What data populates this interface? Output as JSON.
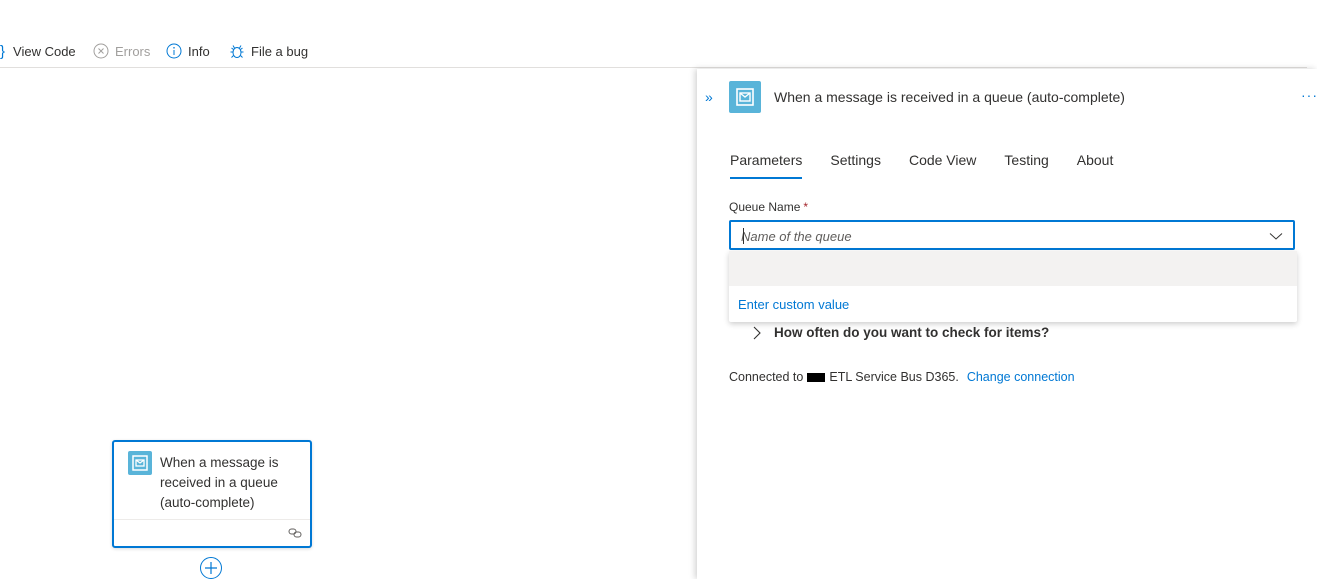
{
  "toolbar": {
    "view_code": "View Code",
    "errors": "Errors",
    "info": "Info",
    "file_bug": "File a bug"
  },
  "canvas": {
    "card_title": "When a message is received in a queue (auto-complete)"
  },
  "panel": {
    "collapse": "»",
    "title": "When a message is received in a queue (auto-complete)",
    "more": "···",
    "tabs": [
      {
        "label": "Parameters"
      },
      {
        "label": "Settings"
      },
      {
        "label": "Code View"
      },
      {
        "label": "Testing"
      },
      {
        "label": "About"
      }
    ],
    "queue_label": "Queue Name",
    "required_mark": "*",
    "queue_placeholder": "Name of the queue",
    "custom_value": "Enter custom value",
    "check_items": "How often do you want to check for items?",
    "connected_prefix": "Connected to",
    "connected_name": "ETL Service Bus D365.",
    "change_connection": "Change connection"
  },
  "colors": {
    "accent": "#0078d4",
    "service_bus": "#59b4d9",
    "required": "#a4262c"
  }
}
